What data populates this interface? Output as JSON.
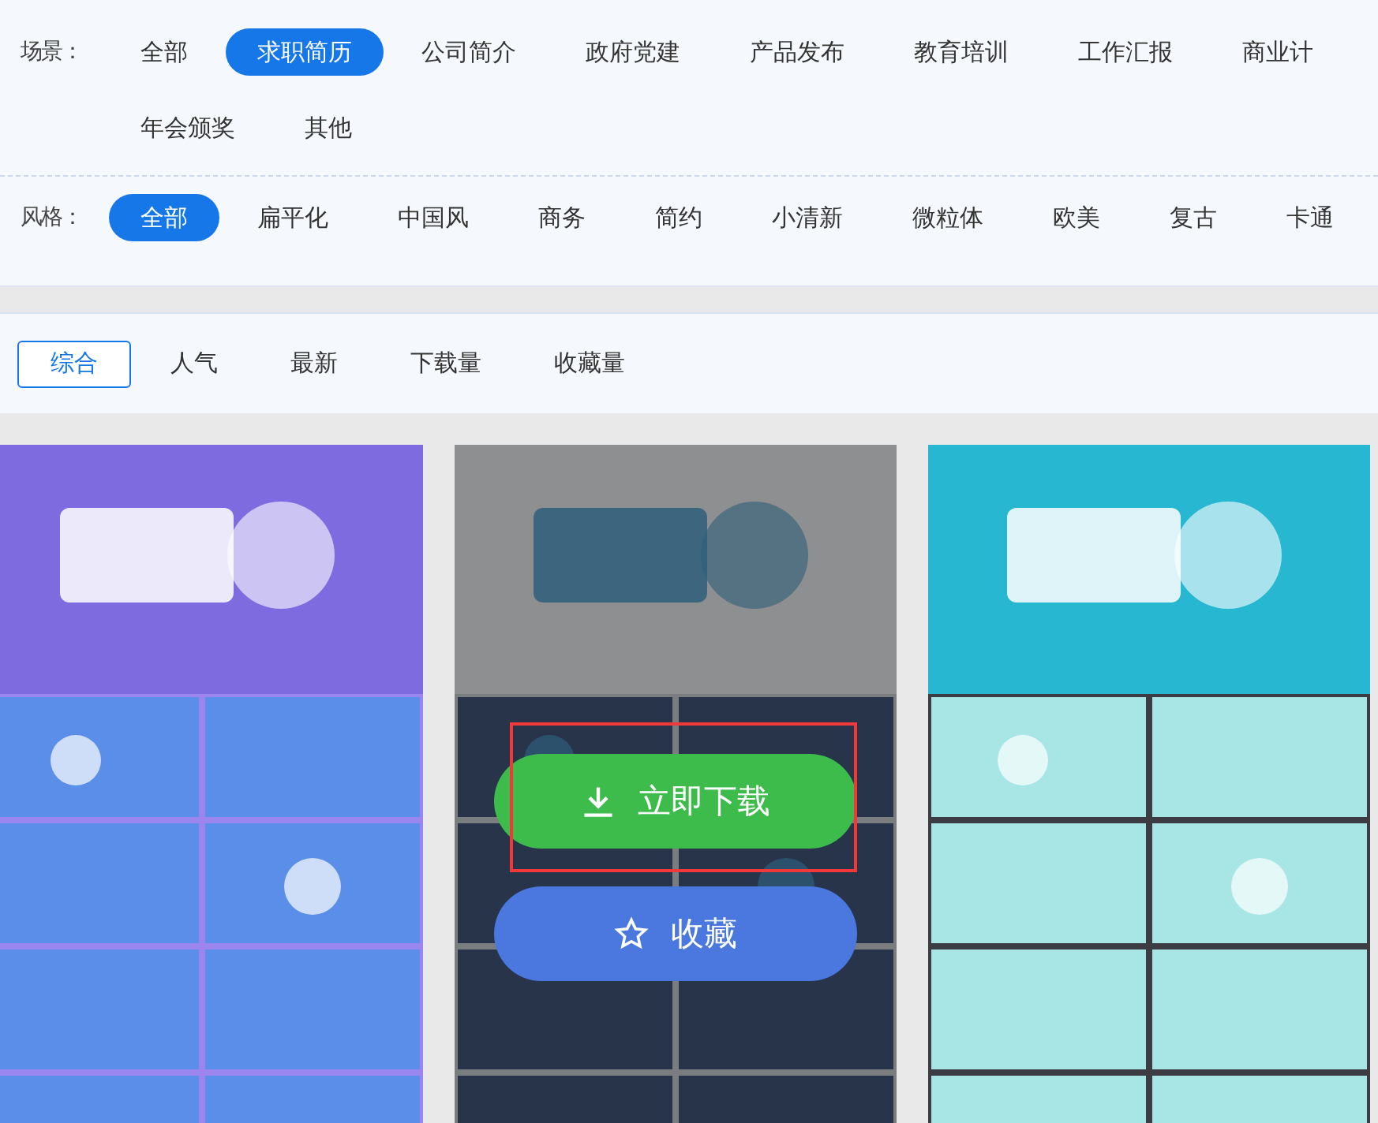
{
  "filters": [
    {
      "label": "场景：",
      "options": [
        {
          "label": "全部",
          "selected": false
        },
        {
          "label": "求职简历",
          "selected": true
        },
        {
          "label": "公司简介",
          "selected": false
        },
        {
          "label": "政府党建",
          "selected": false
        },
        {
          "label": "产品发布",
          "selected": false
        },
        {
          "label": "教育培训",
          "selected": false
        },
        {
          "label": "工作汇报",
          "selected": false
        },
        {
          "label": "商业计",
          "selected": false
        },
        {
          "label": "年会颁奖",
          "selected": false
        },
        {
          "label": "其他",
          "selected": false
        }
      ]
    },
    {
      "label": "风格：",
      "options": [
        {
          "label": "全部",
          "selected": true
        },
        {
          "label": "扁平化",
          "selected": false
        },
        {
          "label": "中国风",
          "selected": false
        },
        {
          "label": "商务",
          "selected": false
        },
        {
          "label": "简约",
          "selected": false
        },
        {
          "label": "小清新",
          "selected": false
        },
        {
          "label": "微粒体",
          "selected": false
        },
        {
          "label": "欧美",
          "selected": false
        },
        {
          "label": "复古",
          "selected": false
        },
        {
          "label": "卡通",
          "selected": false
        }
      ]
    }
  ],
  "sort_tabs": [
    {
      "label": "综合",
      "selected": true
    },
    {
      "label": "人气",
      "selected": false
    },
    {
      "label": "最新",
      "selected": false
    },
    {
      "label": "下载量",
      "selected": false
    },
    {
      "label": "收藏量",
      "selected": false
    }
  ],
  "cards": [
    {
      "kind": "picture",
      "hovered": false
    },
    {
      "kind": "picture",
      "hovered": true,
      "actions": [
        {
          "kind": "download",
          "label": "立即下载",
          "highlighted": true
        },
        {
          "kind": "favorite",
          "label": "收藏",
          "highlighted": false
        }
      ]
    },
    {
      "kind": "picture",
      "hovered": false
    }
  ]
}
